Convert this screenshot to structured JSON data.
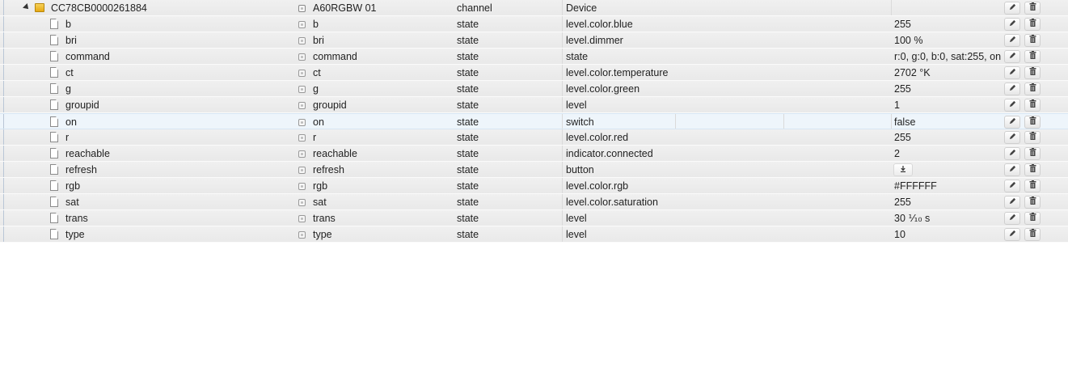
{
  "channel": {
    "id": "CC78CB0000261884",
    "name": "A60RGBW 01",
    "type": "channel",
    "role": "Device",
    "value": "",
    "expander_icon": "triangle-expanded",
    "folder_icon": "folder-icon"
  },
  "states": [
    {
      "id": "b",
      "name": "b",
      "type": "state",
      "role": "level.color.blue",
      "value": "255"
    },
    {
      "id": "bri",
      "name": "bri",
      "type": "state",
      "role": "level.dimmer",
      "value": "100 %"
    },
    {
      "id": "command",
      "name": "command",
      "type": "state",
      "role": "state",
      "value": "r:0, g:0, b:0, sat:255, on"
    },
    {
      "id": "ct",
      "name": "ct",
      "type": "state",
      "role": "level.color.temperature",
      "value": "2702 °K"
    },
    {
      "id": "g",
      "name": "g",
      "type": "state",
      "role": "level.color.green",
      "value": "255"
    },
    {
      "id": "groupid",
      "name": "groupid",
      "type": "state",
      "role": "level",
      "value": "1"
    },
    {
      "id": "on",
      "name": "on",
      "type": "state",
      "role": "switch",
      "value": "false"
    },
    {
      "id": "r",
      "name": "r",
      "type": "state",
      "role": "level.color.red",
      "value": "255"
    },
    {
      "id": "reachable",
      "name": "reachable",
      "type": "state",
      "role": "indicator.connected",
      "value": "2"
    },
    {
      "id": "refresh",
      "name": "refresh",
      "type": "state",
      "role": "button",
      "value": "",
      "value_button_icon": "download-icon"
    },
    {
      "id": "rgb",
      "name": "rgb",
      "type": "state",
      "role": "level.color.rgb",
      "value": "#FFFFFF"
    },
    {
      "id": "sat",
      "name": "sat",
      "type": "state",
      "role": "level.color.saturation",
      "value": "255"
    },
    {
      "id": "trans",
      "name": "trans",
      "type": "state",
      "role": "level",
      "value": "30 ⅒ s"
    },
    {
      "id": "type",
      "name": "type",
      "type": "state",
      "role": "level",
      "value": "10"
    }
  ],
  "highlighted_row": "on",
  "icons": {
    "edit": "pencil-icon",
    "delete": "trash-icon",
    "state": "file-icon",
    "object": "state-object-icon"
  },
  "colors": {
    "row_bg": "#ececec",
    "highlight_bg": "#eef5fb",
    "tree_line": "#b9c6d6"
  }
}
